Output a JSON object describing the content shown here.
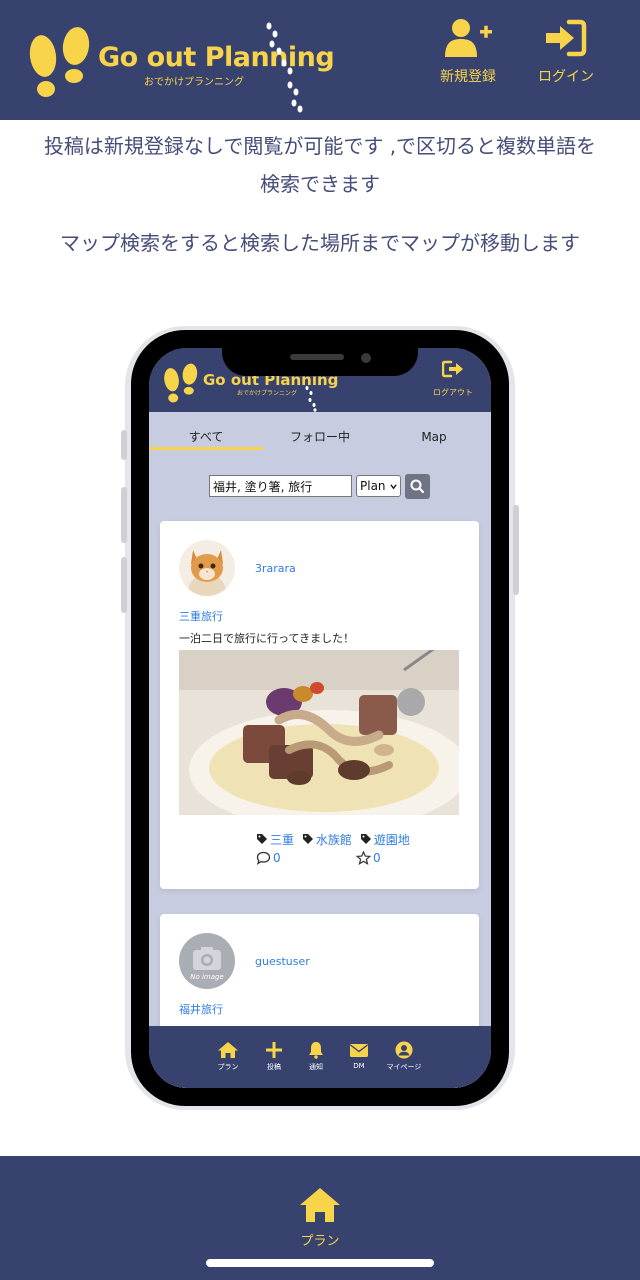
{
  "header": {
    "logo_title": "Go out Planning",
    "logo_subtitle": "おでかけプランニング",
    "register_label": "新規登録",
    "login_label": "ログイン",
    "accent_color": "#f7d44a",
    "background_color": "#38426f"
  },
  "description": {
    "line1": "投稿は新規登録なしで閲覧が可能です ,で区切ると複数単語を検索できます",
    "line2": "マップ検索をすると検索した場所までマップが移動します"
  },
  "phone": {
    "header": {
      "logo_title": "Go out Planning",
      "logo_subtitle": "おでかけプランニング",
      "logout_label": "ログアウト"
    },
    "tabs": [
      {
        "label": "すべて",
        "active": true
      },
      {
        "label": "フォロー中",
        "active": false
      },
      {
        "label": "Map",
        "active": false
      }
    ],
    "search": {
      "value": "福井, 塗り箸, 旅行",
      "select_value": "Plan"
    },
    "posts": [
      {
        "username": "3rarara",
        "title": "三重旅行",
        "text": "一泊二日で旅行に行ってきました！",
        "tags": [
          "三重",
          "水族館",
          "遊園地"
        ],
        "comments": "0",
        "favorites": "0"
      },
      {
        "username": "guestuser",
        "title": "福井旅行",
        "avatar_text": "No image"
      }
    ],
    "footer": [
      {
        "label": "プラン",
        "icon": "home-icon"
      },
      {
        "label": "投稿",
        "icon": "plus-icon"
      },
      {
        "label": "通知",
        "icon": "bell-icon"
      },
      {
        "label": "DM",
        "icon": "envelope-icon"
      },
      {
        "label": "マイページ",
        "icon": "user-circle-icon"
      }
    ]
  },
  "bottom_nav": {
    "plan_label": "プラン"
  }
}
